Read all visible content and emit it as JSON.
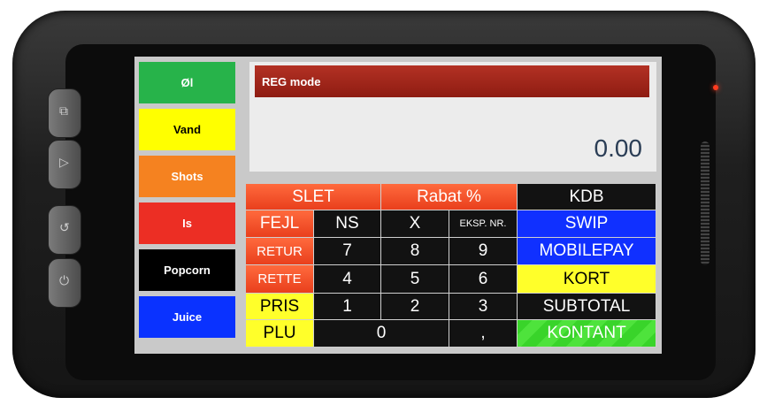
{
  "categories": [
    {
      "label": "Øl",
      "color": "#27b34a",
      "text_color": "#ffffff"
    },
    {
      "label": "Vand",
      "color": "#ffff00",
      "text_color": "#000000"
    },
    {
      "label": "Shots",
      "color": "#f58220",
      "text_color": "#ffffff"
    },
    {
      "label": "Is",
      "color": "#ec2e24",
      "text_color": "#ffffff"
    },
    {
      "label": "Popcorn",
      "color": "#000000",
      "text_color": "#ffffff"
    },
    {
      "label": "Juice",
      "color": "#0a32ff",
      "text_color": "#ffffff"
    }
  ],
  "display": {
    "mode": "REG mode",
    "amount": "0.00"
  },
  "keys": {
    "slet": "SLET",
    "rabat": "Rabat %",
    "kdb": "KDB",
    "fejl": "FEJL",
    "ns": "NS",
    "x": "X",
    "eksp_nr": "EKSP. NR.",
    "swip": "SWIP",
    "retur": "RETUR",
    "k7": "7",
    "k8": "8",
    "k9": "9",
    "mobilepay": "MOBILEPAY",
    "rette": "RETTE",
    "k4": "4",
    "k5": "5",
    "k6": "6",
    "kort": "KORT",
    "pris": "PRIS",
    "k1": "1",
    "k2": "2",
    "k3": "3",
    "subtotal": "SUBTOTAL",
    "plu": "PLU",
    "k0": "0",
    "comma": ",",
    "kontant": "KONTANT"
  },
  "side_buttons": [
    {
      "icon": "copy-icon",
      "glyph": "⧉"
    },
    {
      "icon": "tag-icon",
      "glyph": "▷"
    },
    {
      "icon": "refresh-icon",
      "glyph": "↺"
    },
    {
      "icon": "power-icon",
      "glyph": "⏻"
    }
  ]
}
